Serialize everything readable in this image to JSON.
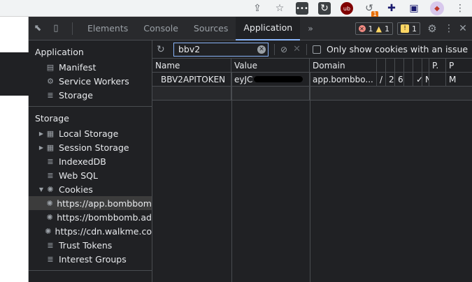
{
  "browser": {
    "toolbar_icons": [
      "share-icon",
      "star-icon",
      "extension-dots-icon",
      "refresh-extension-icon",
      "ublock-icon",
      "extension-badge-icon",
      "puzzle-icon",
      "sidebar-icon",
      "avatar-icon",
      "menu-kebab-icon"
    ],
    "ext_badge": "1"
  },
  "devtools": {
    "tabs": [
      {
        "label": "Elements"
      },
      {
        "label": "Console"
      },
      {
        "label": "Sources"
      },
      {
        "label": "Application"
      }
    ],
    "more_tabs": "»",
    "errors_count": "1",
    "warnings_count": "1",
    "issues_count": "1"
  },
  "sidebar": {
    "application_heading": "Application",
    "application_items": [
      {
        "label": "Manifest",
        "icon": "file-icon"
      },
      {
        "label": "Service Workers",
        "icon": "gear-icon"
      },
      {
        "label": "Storage",
        "icon": "database-icon"
      }
    ],
    "storage_heading": "Storage",
    "storage_items": [
      {
        "label": "Local Storage"
      },
      {
        "label": "Session Storage"
      },
      {
        "label": "IndexedDB"
      },
      {
        "label": "Web SQL"
      },
      {
        "label": "Cookies"
      }
    ],
    "cookie_origins": [
      {
        "label": "https://app.bombbom"
      },
      {
        "label": "https://bombbomb.ad"
      },
      {
        "label": "https://cdn.walkme.co"
      }
    ],
    "other_items": [
      {
        "label": "Trust Tokens"
      },
      {
        "label": "Interest Groups"
      }
    ]
  },
  "cookies": {
    "filter_value": "bbv2",
    "only_issue_label": "Only show cookies with an issue",
    "columns": [
      "Name",
      "Value",
      "Domain",
      "P.",
      "P"
    ],
    "row": {
      "name": "BBV2APITOKEN",
      "value": "eyJC",
      "domain": "app.bombbo...",
      "path": "/",
      "expires": "2.",
      "size": "6.",
      "httponly": "✓",
      "secure": "N",
      "priority": "M"
    }
  }
}
